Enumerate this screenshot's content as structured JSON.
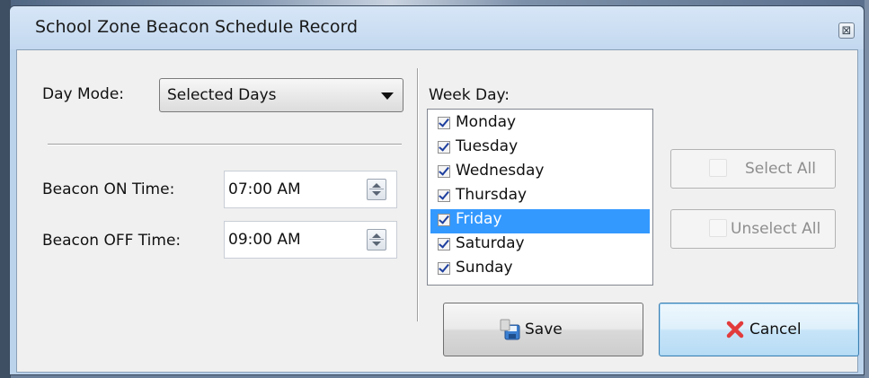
{
  "window": {
    "title": "School Zone Beacon Schedule Record",
    "close_glyph": "⊠"
  },
  "day_mode": {
    "label": "Day Mode:",
    "value": "Selected Days"
  },
  "beacon_on": {
    "label": "Beacon ON Time:",
    "value": "07:00 AM"
  },
  "beacon_off": {
    "label": "Beacon OFF Time:",
    "value": "09:00 AM"
  },
  "week_day": {
    "label": "Week Day:",
    "items": [
      {
        "label": "Monday",
        "checked": true
      },
      {
        "label": "Tuesday",
        "checked": true
      },
      {
        "label": "Wednesday",
        "checked": true
      },
      {
        "label": "Thursday",
        "checked": true
      },
      {
        "label": "Friday",
        "checked": true,
        "selected": true
      },
      {
        "label": "Saturday",
        "checked": true
      },
      {
        "label": "Sunday",
        "checked": true
      }
    ]
  },
  "buttons": {
    "select_all": "Select All",
    "unselect_all": "Unselect All",
    "save": "Save",
    "cancel": "Cancel"
  },
  "colors": {
    "selection": "#3399ff",
    "cancel_icon": "#e23b3b",
    "save_icon": "#3b7fd1"
  },
  "icons": {
    "save": "save-disk-icon",
    "cancel": "x-cancel-icon",
    "close": "close-icon"
  }
}
